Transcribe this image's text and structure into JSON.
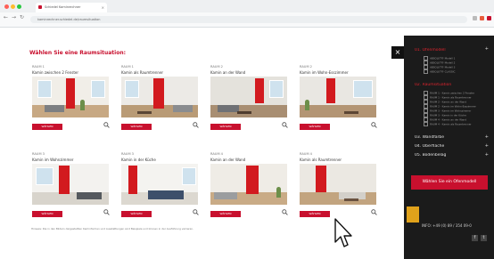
{
  "browser": {
    "tab_title": "Schiedel Kaminrechner",
    "tab_close": "×",
    "address": "kaminrechner.schiedel.de/raumsituation",
    "nav_back": "←",
    "nav_forward": "→",
    "nav_reload": "↻"
  },
  "page": {
    "heading": "Wählen Sie eine Raumsituation:",
    "button_label": "WÄHLEN",
    "rooms": [
      {
        "label1": "RAUM 1",
        "label2": "Kamin zwischen 2 Fenster"
      },
      {
        "label1": "RAUM 1",
        "label2": "Kamin als Raumtrenner"
      },
      {
        "label1": "RAUM 2",
        "label2": "Kamin an der Wand"
      },
      {
        "label1": "RAUM 2",
        "label2": "Kamin im Wohn-Esszimmer"
      },
      {
        "label1": "RAUM 3",
        "label2": "Kamin im Wohnzimmer"
      },
      {
        "label1": "RAUM 3",
        "label2": "Kamin in der Küche"
      },
      {
        "label1": "RAUM 4",
        "label2": "Kamin an der Wand"
      },
      {
        "label1": "RAUM 4",
        "label2": "Kamin als Raumtrenner"
      }
    ],
    "footnote": "Hinweis: Die in den Bildern dargestellten Kaminformen und Ausstattungen sind Beispiele und können in der Ausführung variieren."
  },
  "overlay": {
    "close_label": "×"
  },
  "sidebar": {
    "section1": "01. Ofenmodell",
    "section1_items": [
      "ABSOLUT® Modell 1",
      "ABSOLUT® Modell 2",
      "ABSOLUT® Modell 3",
      "ABSOLUT® CLASSIC"
    ],
    "section2": "02. Raumsituation",
    "section2_items": [
      "RAUM 1 - Kamin zwischen 2 Fenster",
      "RAUM 1 - Kamin als Raumtrenner",
      "RAUM 2 - Kamin an der Wand",
      "RAUM 2 - Kamin im Wohn-Esszimmer",
      "RAUM 3 - Kamin im Wohnzimmer",
      "RAUM 3 - Kamin in der Küche",
      "RAUM 4 - Kamin an der Wand",
      "RAUM 4 - Kamin als Raumtrenner"
    ],
    "section3": "03. Wandfarbe",
    "section4": "04. Oberfläche",
    "section5": "05. Bodenbelag",
    "plus": "+",
    "cta": "Wählen Sie ein Ofenmodell",
    "phone": "INFO: +49 (0) 89 / 354 09-0",
    "social": [
      "f",
      "t"
    ]
  },
  "colors": {
    "accent": "#c8102e",
    "sidebar_bg": "#1b1b1b",
    "sidebar_active": "#e0242e",
    "logo": "#e0a21b"
  },
  "icons": {
    "zoom": "magnifier-icon",
    "close": "close-icon",
    "cursor": "arrow-cursor-icon"
  }
}
